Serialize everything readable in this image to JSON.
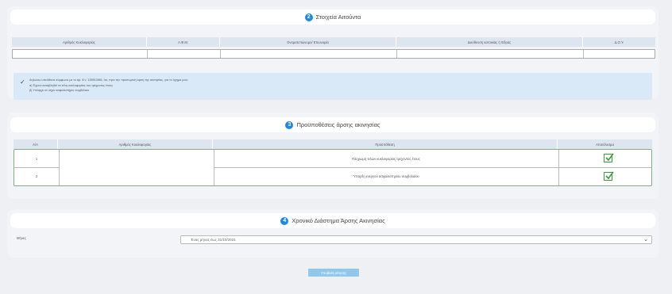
{
  "section1": {
    "number": "2",
    "title": "Στοιχεία Αιτούντα",
    "columns": [
      "Αριθμός Κυκλοφορίας",
      "Α.Φ.Μ.",
      "Ονοματεπώνυμο/ Επωνυμία",
      "Διεύθυνση κατοικίας ή Έδρας",
      "Δ.Ο.Υ."
    ],
    "declaration": {
      "line1": "Δηλώνω υπεύθυνα σύμφωνα με το άρ. 8 ν. 1599/1986, ότι, πριν την προσωρινή άρση της ακινησίας, για το όχημα μου:",
      "line2": "α) Έχουν καταβληθεί τα τέλη κυκλοφορίας του τρέχοντος έτους",
      "line3": "β) Υπάρχει εν ισχύι ασφαλιστήριο συμβόλαιο"
    }
  },
  "section2": {
    "number": "3",
    "title": "Προϋποθέσεις άρσης ακινησίας",
    "columns": [
      "Α/Α",
      "Αριθμός Κυκλοφορίας",
      "Προϋπόθεση",
      "Αποτέλεσμα"
    ],
    "rows": [
      {
        "aa": "1",
        "condition": "Πληρωμή τελών κυκλοφορίας τρέχοντος έτους"
      },
      {
        "aa": "2",
        "condition": "Ύπαρξη ενεργού ασφαλιστηρίου συμβολαίου"
      }
    ]
  },
  "section3": {
    "number": "4",
    "title": "Χρονικό Διάστημα Άρσης Ακινησίας",
    "months_label": "Μήνες",
    "selected": "Ένας μήνας έως 31/10/2021"
  },
  "submit_label": "Υποβολή αίτησης",
  "colors": {
    "accent": "#1e88e5",
    "ok": "#3a9a3a",
    "button": "#8fc8ec"
  }
}
